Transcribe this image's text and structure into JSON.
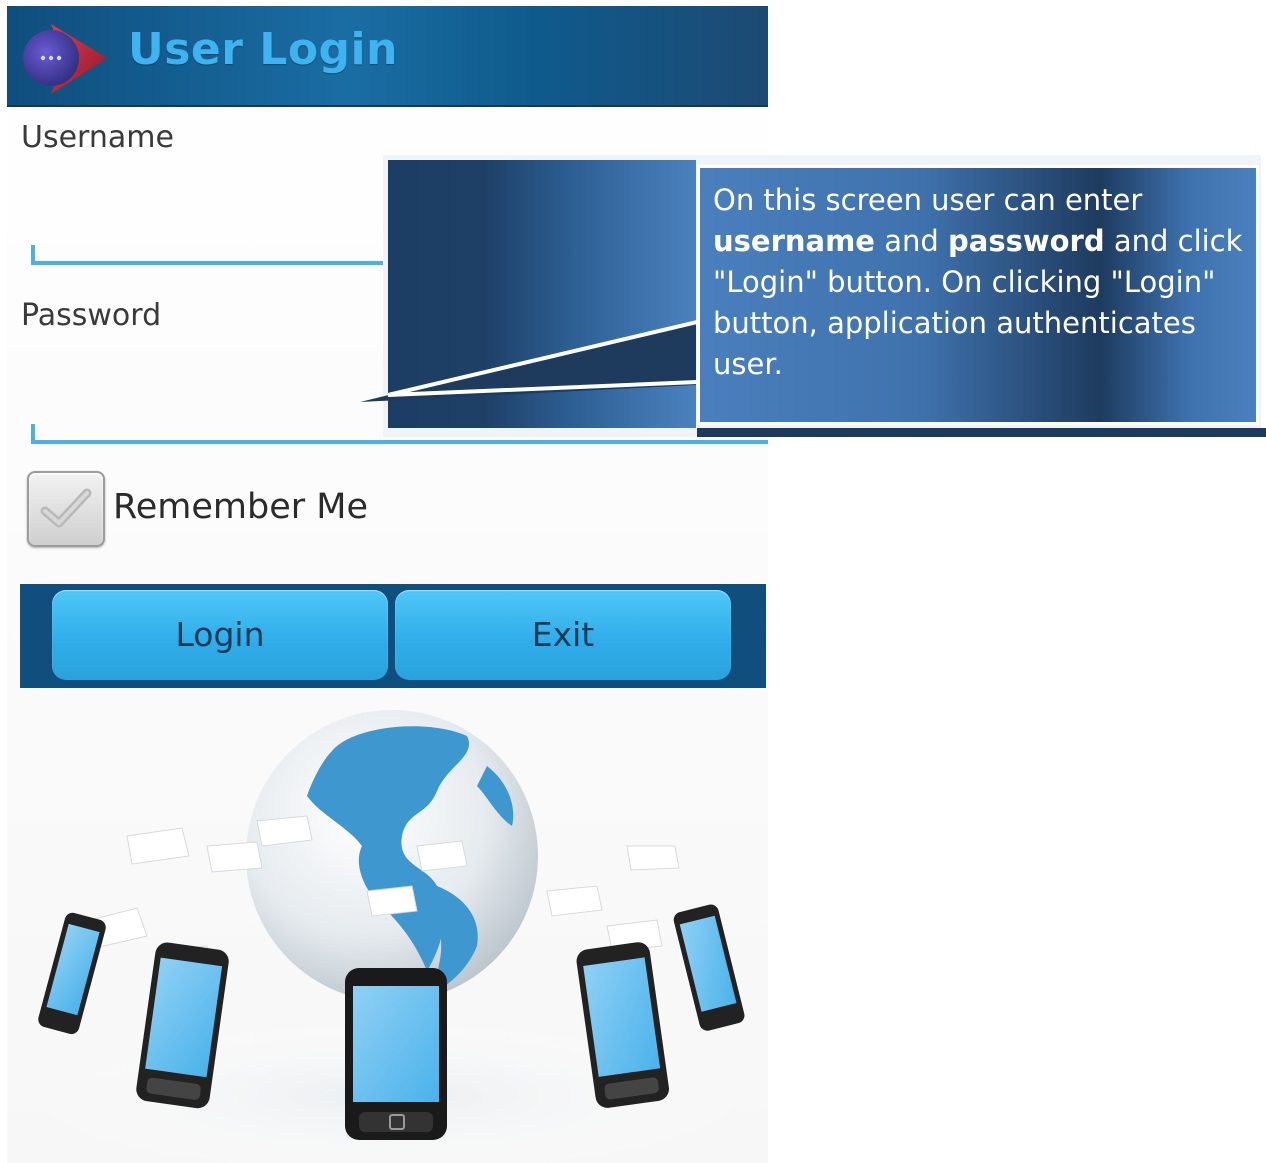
{
  "app": {
    "title": "User Login"
  },
  "form": {
    "username_label": "Username",
    "username_value": "",
    "password_label": "Password",
    "password_value": "",
    "remember_label": "Remember Me",
    "remember_checked": true
  },
  "buttons": {
    "login_label": "Login",
    "exit_label": "Exit"
  },
  "callout": {
    "text_1": "On this screen user can enter ",
    "bold_1": "username",
    "text_2": " and ",
    "bold_2": "password",
    "text_3": " and click \"Login\" button. On clicking \"Login\" button, application authenticates user."
  },
  "colors": {
    "accent": "#4bb1df",
    "titlebar": "#0f4e7d",
    "title_text": "#3fb3ef",
    "button": "#30aeea",
    "callout": "#3f72ad"
  },
  "icons": {
    "app_logo": "app-logo-icon",
    "checkbox_check": "checkmark-icon"
  }
}
